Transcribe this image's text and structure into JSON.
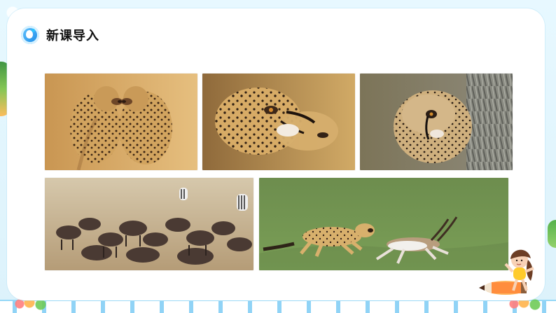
{
  "header": {
    "title": "新课导入",
    "icon": "brand-icon"
  },
  "images": [
    {
      "name": "cheetahs-touching-photo"
    },
    {
      "name": "cheetah-face-closeup-photo"
    },
    {
      "name": "cheetah-by-tree-photo"
    },
    {
      "name": "wildebeest-migration-photo"
    },
    {
      "name": "cheetah-chasing-gazelle-photo"
    }
  ],
  "decoration": {
    "character": "girl-riding-pencil"
  }
}
